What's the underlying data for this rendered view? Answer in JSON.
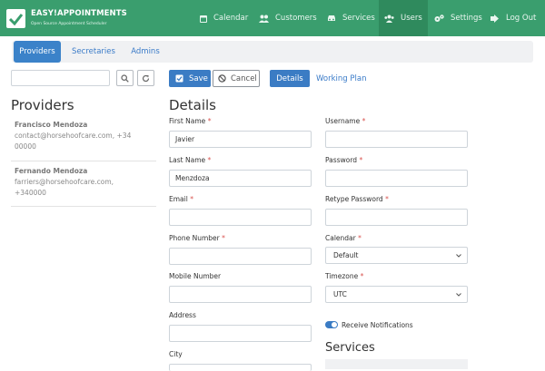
{
  "header": {
    "brand_title": "EASY!APPOINTMENTS",
    "brand_subtitle": "Open Source Appointment Scheduler",
    "nav": [
      {
        "label": "Calendar",
        "icon": "calendar-icon"
      },
      {
        "label": "Customers",
        "icon": "customers-icon"
      },
      {
        "label": "Services",
        "icon": "services-icon"
      },
      {
        "label": "Users",
        "icon": "users-icon",
        "active": true
      },
      {
        "label": "Settings",
        "icon": "settings-icon"
      },
      {
        "label": "Log Out",
        "icon": "logout-icon"
      }
    ]
  },
  "tabs": [
    {
      "label": "Providers",
      "active": true
    },
    {
      "label": "Secretaries"
    },
    {
      "label": "Admins"
    }
  ],
  "toolbar": {
    "save_label": "Save",
    "cancel_label": "Cancel",
    "details_label": "Details",
    "working_plan_label": "Working Plan"
  },
  "providers_panel": {
    "title": "Providers",
    "items": [
      {
        "name": "Francisco Mendoza",
        "info_line1": "contact@horsehoofcare.com, +34",
        "info_line2": "00000"
      },
      {
        "name": "Fernando Mendoza",
        "info_line1": "farriers@horsehoofcare.com,",
        "info_line2": "+340000"
      }
    ]
  },
  "details": {
    "title": "Details",
    "required_mark": "*",
    "first_name": {
      "label": "First Name",
      "value": "Javier"
    },
    "last_name": {
      "label": "Last Name",
      "value": "Menzdoza"
    },
    "email": {
      "label": "Email",
      "value": ""
    },
    "phone": {
      "label": "Phone Number",
      "value": ""
    },
    "mobile": {
      "label": "Mobile Number",
      "value": ""
    },
    "address": {
      "label": "Address",
      "value": ""
    },
    "city": {
      "label": "City"
    },
    "username": {
      "label": "Username",
      "value": ""
    },
    "password": {
      "label": "Password",
      "value": ""
    },
    "retype_password": {
      "label": "Retype Password",
      "value": ""
    },
    "calendar": {
      "label": "Calendar",
      "value": "Default"
    },
    "timezone": {
      "label": "Timezone",
      "value": "UTC"
    },
    "notifications": {
      "label": "Receive Notifications",
      "enabled": true
    },
    "services_title": "Services"
  },
  "colors": {
    "brand": "#3a9e6e",
    "primary": "#3b7cc4",
    "required": "#d9534f"
  }
}
